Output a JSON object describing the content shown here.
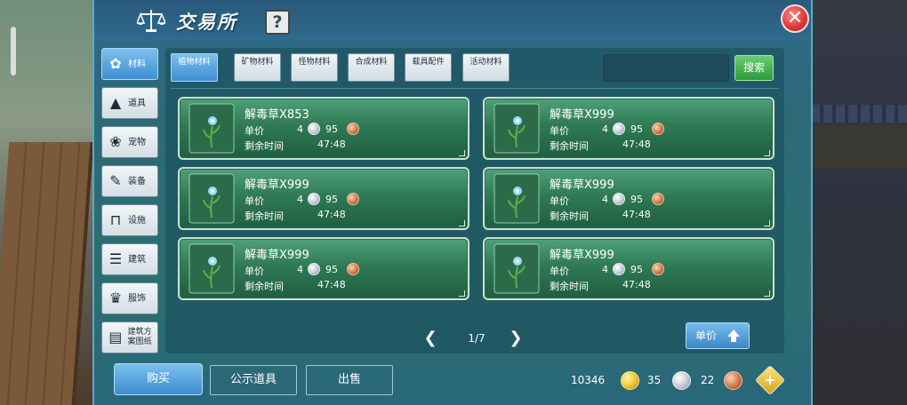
{
  "header": {
    "title": "交易所",
    "help_label": "?",
    "close_label": "✕"
  },
  "categories": [
    {
      "label": "材料",
      "icon": "material-icon",
      "glyph": "✿",
      "active": true
    },
    {
      "label": "道具",
      "icon": "item-icon",
      "glyph": "▲",
      "active": false
    },
    {
      "label": "宠物",
      "icon": "pet-paw-icon",
      "glyph": "❀",
      "active": false
    },
    {
      "label": "装备",
      "icon": "equipment-icon",
      "glyph": "✎",
      "active": false
    },
    {
      "label": "设施",
      "icon": "facility-icon",
      "glyph": "⊓",
      "active": false
    },
    {
      "label": "建筑",
      "icon": "building-icon",
      "glyph": "☰",
      "active": false
    },
    {
      "label": "服饰",
      "icon": "clothing-icon",
      "glyph": "♛",
      "active": false
    },
    {
      "label": "建筑方案图纸",
      "icon": "blueprint-icon",
      "glyph": "▤",
      "active": false
    }
  ],
  "subtabs": [
    {
      "label": "植物材料",
      "active": true
    },
    {
      "label": "矿物材料",
      "active": false
    },
    {
      "label": "怪物材料",
      "active": false
    },
    {
      "label": "合成材料",
      "active": false
    },
    {
      "label": "载具配件",
      "active": false
    },
    {
      "label": "活动材料",
      "active": false
    }
  ],
  "search": {
    "value": "",
    "button_label": "搜索"
  },
  "listing_labels": {
    "price_label": "单价",
    "time_label": "剩余时间"
  },
  "listings": [
    {
      "name": "解毒草X853",
      "silver": "4",
      "copper": "95",
      "time_left": "47:48"
    },
    {
      "name": "解毒草X999",
      "silver": "4",
      "copper": "95",
      "time_left": "47:48"
    },
    {
      "name": "解毒草X999",
      "silver": "4",
      "copper": "95",
      "time_left": "47:48"
    },
    {
      "name": "解毒草X999",
      "silver": "4",
      "copper": "95",
      "time_left": "47:48"
    },
    {
      "name": "解毒草X999",
      "silver": "4",
      "copper": "95",
      "time_left": "47:48"
    },
    {
      "name": "解毒草X999",
      "silver": "4",
      "copper": "95",
      "time_left": "47:48"
    }
  ],
  "pagination": {
    "page_text": "1/7",
    "prev": "❮",
    "next": "❯"
  },
  "sort": {
    "label": "单价"
  },
  "bottom": {
    "buy_label": "购买",
    "public_label": "公示道具",
    "sell_label": "出售"
  },
  "currency": {
    "gold": "10346",
    "silver": "35",
    "copper": "22",
    "add_label": "+"
  },
  "colors": {
    "accent_blue": "#3d8ed1",
    "search_green": "#2e9a3c",
    "card_green": "#2f7a55",
    "close_red": "#e03a3a"
  }
}
